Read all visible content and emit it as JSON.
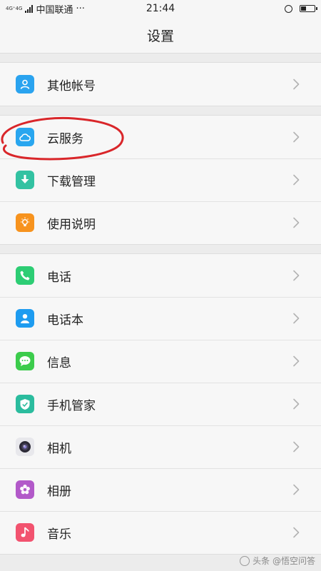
{
  "status_bar": {
    "network_tag": "4G⁺4G",
    "carrier": "中国联通",
    "more": "···",
    "time": "21:44"
  },
  "header": {
    "title": "设置"
  },
  "groups": [
    {
      "items": [
        {
          "label": "其他帐号",
          "icon": "person-icon",
          "color": "#2aa3ef"
        }
      ]
    },
    {
      "items": [
        {
          "label": "云服务",
          "icon": "cloud-icon",
          "color": "#29a6ef"
        },
        {
          "label": "下载管理",
          "icon": "download-icon",
          "color": "#33c2a2"
        },
        {
          "label": "使用说明",
          "icon": "bulb-icon",
          "color": "#f7931e"
        }
      ]
    },
    {
      "items": [
        {
          "label": "电话",
          "icon": "phone-icon",
          "color": "#2dcd74"
        },
        {
          "label": "电话本",
          "icon": "contacts-icon",
          "color": "#1e9cf0"
        },
        {
          "label": "信息",
          "icon": "message-icon",
          "color": "#3ccc4c"
        },
        {
          "label": "手机管家",
          "icon": "shield-icon",
          "color": "#2bbc9e"
        },
        {
          "label": "相机",
          "icon": "camera-icon",
          "color": "#e8e8ec"
        },
        {
          "label": "相册",
          "icon": "flower-icon",
          "color": "#b259c9"
        },
        {
          "label": "音乐",
          "icon": "music-icon",
          "color": "#f2536f"
        }
      ]
    }
  ],
  "watermark": "头条 @悟空问答"
}
